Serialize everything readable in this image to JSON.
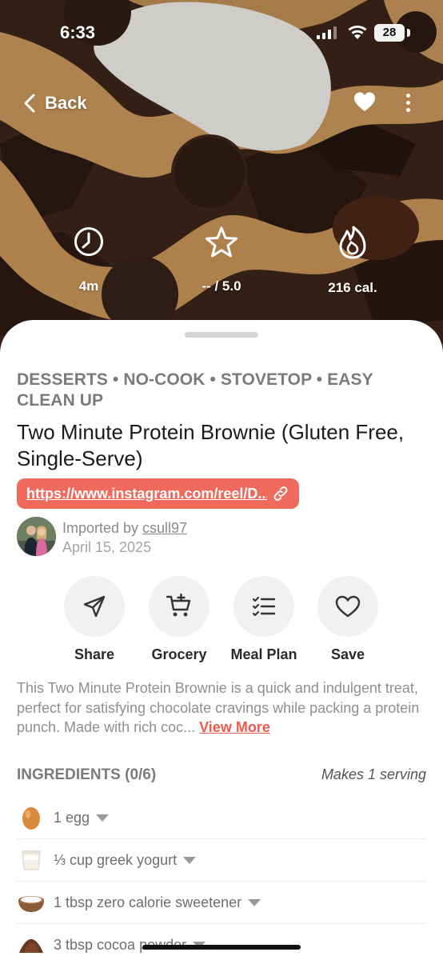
{
  "status_bar": {
    "time": "6:33",
    "battery": "28"
  },
  "nav": {
    "back_label": "Back"
  },
  "stats": [
    {
      "icon": "clock-icon",
      "label": "4m"
    },
    {
      "icon": "star-icon",
      "label": "-- / 5.0"
    },
    {
      "icon": "flame-icon",
      "label": "216 cal."
    }
  ],
  "recipe": {
    "categories": "DESSERTS • NO-COOK • STOVETOP • EASY CLEAN UP",
    "title": "Two Minute Protein Brownie (Gluten Free, Single-Serve)",
    "url": "https://www.instagram.com/reel/D...",
    "imported_by_prefix": "Imported by ",
    "imported_by_user": "csull97",
    "imported_date": "April 15, 2025"
  },
  "actions": [
    {
      "icon": "send-icon",
      "label": "Share"
    },
    {
      "icon": "cart-plus-icon",
      "label": "Grocery"
    },
    {
      "icon": "checklist-icon",
      "label": "Meal Plan"
    },
    {
      "icon": "heart-outline-icon",
      "label": "Save"
    }
  ],
  "description": {
    "text": "This Two Minute Protein Brownie is a quick and indulgent treat, perfect for satisfying chocolate cravings while packing a protein punch. Made with rich coc...",
    "more_label": "View More"
  },
  "ingredients": {
    "header": "INGREDIENTS (0/6)",
    "makes": "Makes 1 serving",
    "items": [
      {
        "icon": "egg-icon",
        "text": "1 egg"
      },
      {
        "icon": "yogurt-icon",
        "text": "⅓ cup greek yogurt"
      },
      {
        "icon": "sweetener-bowl-icon",
        "text": "1 tbsp zero calorie sweetener"
      },
      {
        "icon": "cocoa-powder-icon",
        "text": "3 tbsp cocoa powder"
      }
    ]
  },
  "colors": {
    "accent": "#ef6a5c",
    "link": "#ef5b4c",
    "muted_text": "#8f8f8f"
  }
}
